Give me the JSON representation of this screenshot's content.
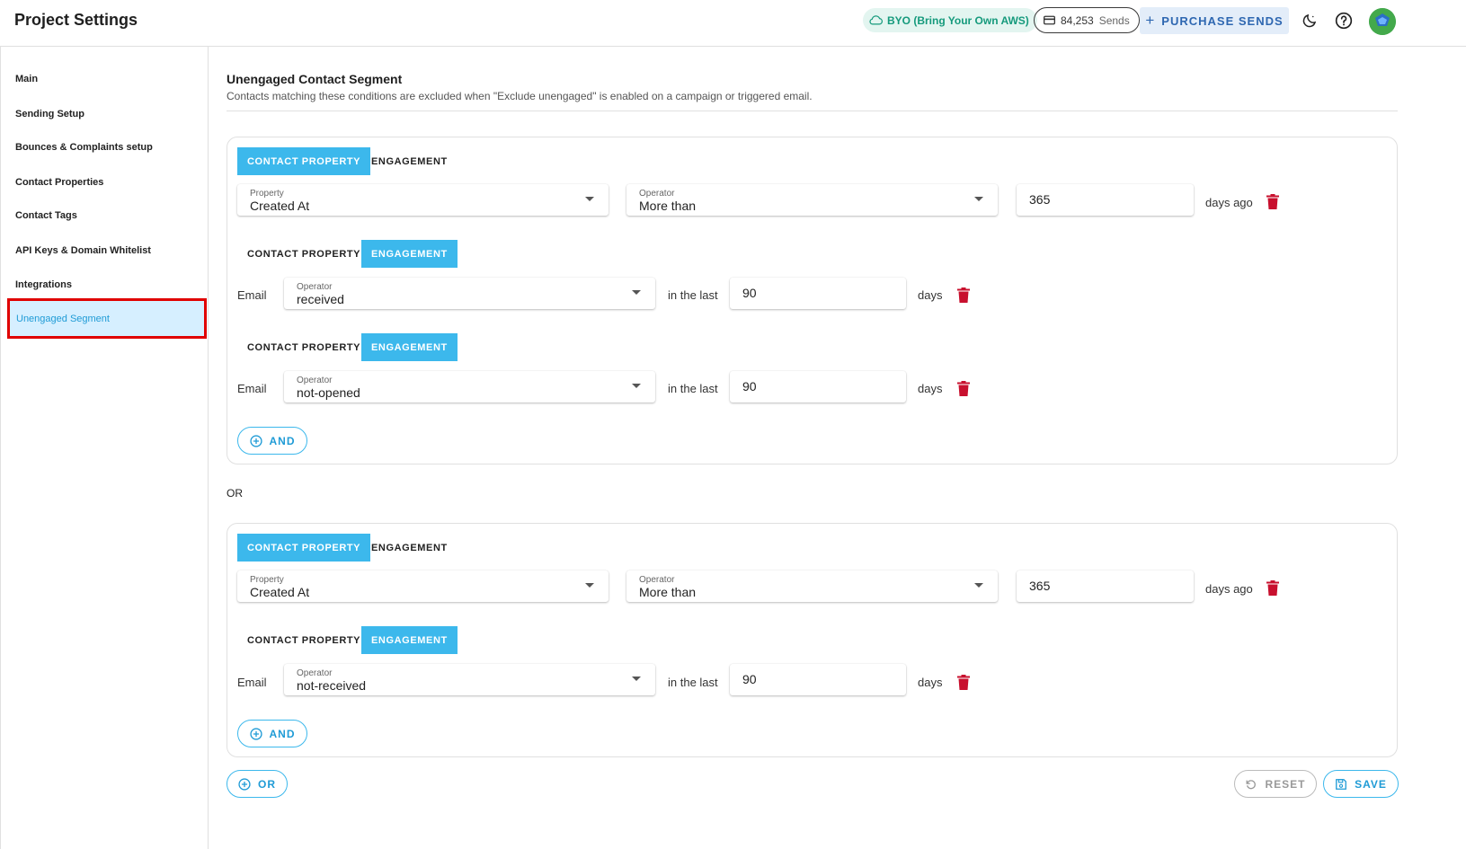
{
  "header": {
    "title": "Project Settings",
    "byo_label": "BYO (Bring Your Own AWS)",
    "sends_count": "84,253",
    "sends_suffix": "Sends",
    "purchase_label": "PURCHASE SENDS",
    "purchase_plus": "+"
  },
  "sidebar": {
    "items": [
      {
        "label": "Main"
      },
      {
        "label": "Sending Setup"
      },
      {
        "label": "Bounces & Complaints setup"
      },
      {
        "label": "Contact Properties"
      },
      {
        "label": "Contact Tags"
      },
      {
        "label": "API Keys & Domain Whitelist"
      },
      {
        "label": "Integrations"
      },
      {
        "label": "Unengaged Segment"
      }
    ],
    "active_index": 7
  },
  "segment": {
    "title": "Unengaged Contact Segment",
    "description": "Contacts matching these conditions are excluded when \"Exclude unengaged\" is enabled on a campaign or triggered email."
  },
  "tabs": {
    "contact_property": "CONTACT PROPERTY",
    "engagement": "ENGAGEMENT"
  },
  "labels": {
    "property": "Property",
    "operator": "Operator",
    "email": "Email",
    "in_the_last": "in the last",
    "days": "days",
    "days_ago": "days ago",
    "and": "AND",
    "or_separator": "OR",
    "or_button": "OR",
    "reset": "RESET",
    "save": "SAVE"
  },
  "groups": [
    {
      "conditions": [
        {
          "type": "contact_property",
          "property": "Created At",
          "operator": "More than",
          "value": "365"
        },
        {
          "type": "engagement",
          "operator": "received",
          "value": "90"
        },
        {
          "type": "engagement",
          "operator": "not-opened",
          "value": "90"
        }
      ]
    },
    {
      "conditions": [
        {
          "type": "contact_property",
          "property": "Created At",
          "operator": "More than",
          "value": "365"
        },
        {
          "type": "engagement",
          "operator": "not-received",
          "value": "90"
        }
      ]
    }
  ],
  "colors": {
    "accent": "#3cb8ec",
    "danger": "#c8102e",
    "highlight_border": "#e00000"
  }
}
